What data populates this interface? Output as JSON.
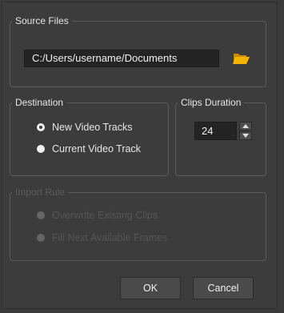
{
  "source_files": {
    "legend": "Source Files",
    "path_value": "C:/Users/username/Documents",
    "browse_icon": "folder-open-icon"
  },
  "destination": {
    "legend": "Destination",
    "options": [
      "New Video Tracks",
      "Current Video Track"
    ],
    "selected": "New Video Tracks"
  },
  "clips_duration": {
    "legend": "Clips Duration",
    "value": "24"
  },
  "import_rule": {
    "legend": "Import Rule",
    "options": [
      "Overwrite Existing Clips",
      "Fill Next Available Frames"
    ],
    "enabled": false
  },
  "buttons": {
    "ok": "OK",
    "cancel": "Cancel"
  },
  "colors": {
    "background": "#3c3c3c",
    "field": "#242424",
    "folder": "#f0b000"
  }
}
